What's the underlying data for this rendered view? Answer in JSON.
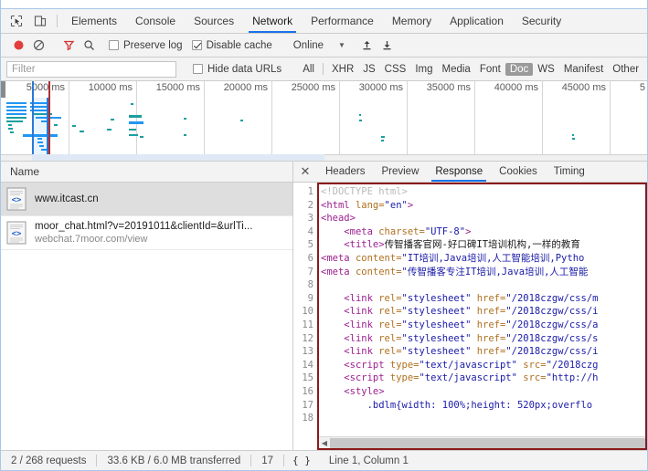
{
  "toolbar_icons": {
    "inspect": "inspect-element-icon",
    "device": "device-toolbar-icon"
  },
  "main_tabs": [
    {
      "label": "Elements",
      "active": false
    },
    {
      "label": "Console",
      "active": false
    },
    {
      "label": "Sources",
      "active": false
    },
    {
      "label": "Network",
      "active": true
    },
    {
      "label": "Performance",
      "active": false
    },
    {
      "label": "Memory",
      "active": false
    },
    {
      "label": "Application",
      "active": false
    },
    {
      "label": "Security",
      "active": false
    }
  ],
  "controls": {
    "record_icon": "record-button-icon",
    "clear_icon": "clear-requests-icon",
    "filter_icon": "filter-funnel-icon",
    "search_icon": "search-icon",
    "preserve_log": {
      "label": "Preserve log",
      "checked": false
    },
    "disable_cache": {
      "label": "Disable cache",
      "checked": true
    },
    "throttling": {
      "value": "Online"
    },
    "import_icon": "import-har-icon",
    "export_icon": "export-har-icon"
  },
  "filterbar": {
    "filter_placeholder": "Filter",
    "hide_data_urls": {
      "label": "Hide data URLs",
      "checked": false
    },
    "types": [
      {
        "label": "All",
        "selected": false
      },
      {
        "label": "XHR",
        "selected": false
      },
      {
        "label": "JS",
        "selected": false
      },
      {
        "label": "CSS",
        "selected": false
      },
      {
        "label": "Img",
        "selected": false
      },
      {
        "label": "Media",
        "selected": false
      },
      {
        "label": "Font",
        "selected": false
      },
      {
        "label": "Doc",
        "selected": true
      },
      {
        "label": "WS",
        "selected": false
      },
      {
        "label": "Manifest",
        "selected": false
      },
      {
        "label": "Other",
        "selected": false
      }
    ]
  },
  "overview": {
    "ticks": [
      "5000 ms",
      "10000 ms",
      "15000 ms",
      "20000 ms",
      "25000 ms",
      "30000 ms",
      "35000 ms",
      "40000 ms",
      "45000 ms",
      "5"
    ]
  },
  "requests": {
    "column_header": "Name",
    "items": [
      {
        "name": "www.itcast.cn",
        "sub": "",
        "selected": true,
        "icon": "document-file-icon"
      },
      {
        "name": "moor_chat.html?v=20191011&clientId=&urlTi...",
        "sub": "webchat.7moor.com/view",
        "selected": false,
        "icon": "document-file-icon"
      }
    ]
  },
  "detail": {
    "close_icon": "close-icon",
    "tabs": [
      {
        "label": "Headers",
        "active": false
      },
      {
        "label": "Preview",
        "active": false
      },
      {
        "label": "Response",
        "active": true
      },
      {
        "label": "Cookies",
        "active": false
      },
      {
        "label": "Timing",
        "active": false
      }
    ],
    "line_numbers": [
      "1",
      "2",
      "3",
      "4",
      "5",
      "6",
      "7",
      "8",
      "9",
      "10",
      "11",
      "12",
      "13",
      "14",
      "15",
      "16",
      "17",
      "18"
    ],
    "code_lines": [
      [
        {
          "t": "doctype",
          "s": "<!DOCTYPE html>"
        }
      ],
      [
        {
          "t": "tag",
          "s": "<html "
        },
        {
          "t": "attr",
          "s": "lang="
        },
        {
          "t": "val",
          "s": "\"en\""
        },
        {
          "t": "tag",
          "s": ">"
        }
      ],
      [
        {
          "t": "tag",
          "s": "<head>"
        }
      ],
      [
        {
          "t": "txt",
          "s": "    "
        },
        {
          "t": "tag",
          "s": "<meta "
        },
        {
          "t": "attr",
          "s": "charset="
        },
        {
          "t": "val",
          "s": "\"UTF-8\""
        },
        {
          "t": "tag",
          "s": ">"
        }
      ],
      [
        {
          "t": "txt",
          "s": "    "
        },
        {
          "t": "tag",
          "s": "<title>"
        },
        {
          "t": "txt",
          "s": "传智播客官网-好口碑IT培训机构,一样的教育"
        }
      ],
      [
        {
          "t": "tag",
          "s": "<meta "
        },
        {
          "t": "attr",
          "s": "content="
        },
        {
          "t": "val",
          "s": "\"IT培训,Java培训,人工智能培训,Pytho"
        }
      ],
      [
        {
          "t": "tag",
          "s": "<meta "
        },
        {
          "t": "attr",
          "s": "content="
        },
        {
          "t": "val",
          "s": "\"传智播客专注IT培训,Java培训,人工智能"
        }
      ],
      [],
      [
        {
          "t": "txt",
          "s": "    "
        },
        {
          "t": "tag",
          "s": "<link "
        },
        {
          "t": "attr",
          "s": "rel="
        },
        {
          "t": "val",
          "s": "\"stylesheet\""
        },
        {
          "t": "attr",
          "s": " href="
        },
        {
          "t": "val",
          "s": "\"/2018czgw/css/m"
        }
      ],
      [
        {
          "t": "txt",
          "s": "    "
        },
        {
          "t": "tag",
          "s": "<link "
        },
        {
          "t": "attr",
          "s": "rel="
        },
        {
          "t": "val",
          "s": "\"stylesheet\""
        },
        {
          "t": "attr",
          "s": " href="
        },
        {
          "t": "val",
          "s": "\"/2018czgw/css/i"
        }
      ],
      [
        {
          "t": "txt",
          "s": "    "
        },
        {
          "t": "tag",
          "s": "<link "
        },
        {
          "t": "attr",
          "s": "rel="
        },
        {
          "t": "val",
          "s": "\"stylesheet\""
        },
        {
          "t": "attr",
          "s": " href="
        },
        {
          "t": "val",
          "s": "\"/2018czgw/css/a"
        }
      ],
      [
        {
          "t": "txt",
          "s": "    "
        },
        {
          "t": "tag",
          "s": "<link "
        },
        {
          "t": "attr",
          "s": "rel="
        },
        {
          "t": "val",
          "s": "\"stylesheet\""
        },
        {
          "t": "attr",
          "s": " href="
        },
        {
          "t": "val",
          "s": "\"/2018czgw/css/s"
        }
      ],
      [
        {
          "t": "txt",
          "s": "    "
        },
        {
          "t": "tag",
          "s": "<link "
        },
        {
          "t": "attr",
          "s": "rel="
        },
        {
          "t": "val",
          "s": "\"stylesheet\""
        },
        {
          "t": "attr",
          "s": " href="
        },
        {
          "t": "val",
          "s": "\"/2018czgw/css/i"
        }
      ],
      [
        {
          "t": "txt",
          "s": "    "
        },
        {
          "t": "tag",
          "s": "<script "
        },
        {
          "t": "attr",
          "s": "type="
        },
        {
          "t": "val",
          "s": "\"text/javascript\""
        },
        {
          "t": "attr",
          "s": " src="
        },
        {
          "t": "val",
          "s": "\"/2018czg"
        }
      ],
      [
        {
          "t": "txt",
          "s": "    "
        },
        {
          "t": "tag",
          "s": "<script "
        },
        {
          "t": "attr",
          "s": "type="
        },
        {
          "t": "val",
          "s": "\"text/javascript\""
        },
        {
          "t": "attr",
          "s": " src="
        },
        {
          "t": "val",
          "s": "\"http://h"
        }
      ],
      [
        {
          "t": "txt",
          "s": "    "
        },
        {
          "t": "tag",
          "s": "<style>"
        }
      ],
      [
        {
          "t": "txt",
          "s": "        "
        },
        {
          "t": "css",
          "s": ".bdlm{width: 100%;height: 520px;overflo"
        }
      ],
      []
    ],
    "scroll_arrow": "scroll-left-arrow-icon"
  },
  "status": {
    "requests": "2 / 268 requests",
    "transferred": "33.6 KB / 6.0 MB transferred",
    "extra": "17",
    "pretty_print": "{ }",
    "cursor": "Line 1, Column 1"
  },
  "colors": {
    "accent": "#1a73e8",
    "record_red": "#e33d3d",
    "filter_red": "#d32f2f",
    "code_border": "#8b1a1a",
    "timeline_teal": "#1b9e9e",
    "timeline_blue": "#2196f3",
    "selected_row": "#dedede"
  }
}
